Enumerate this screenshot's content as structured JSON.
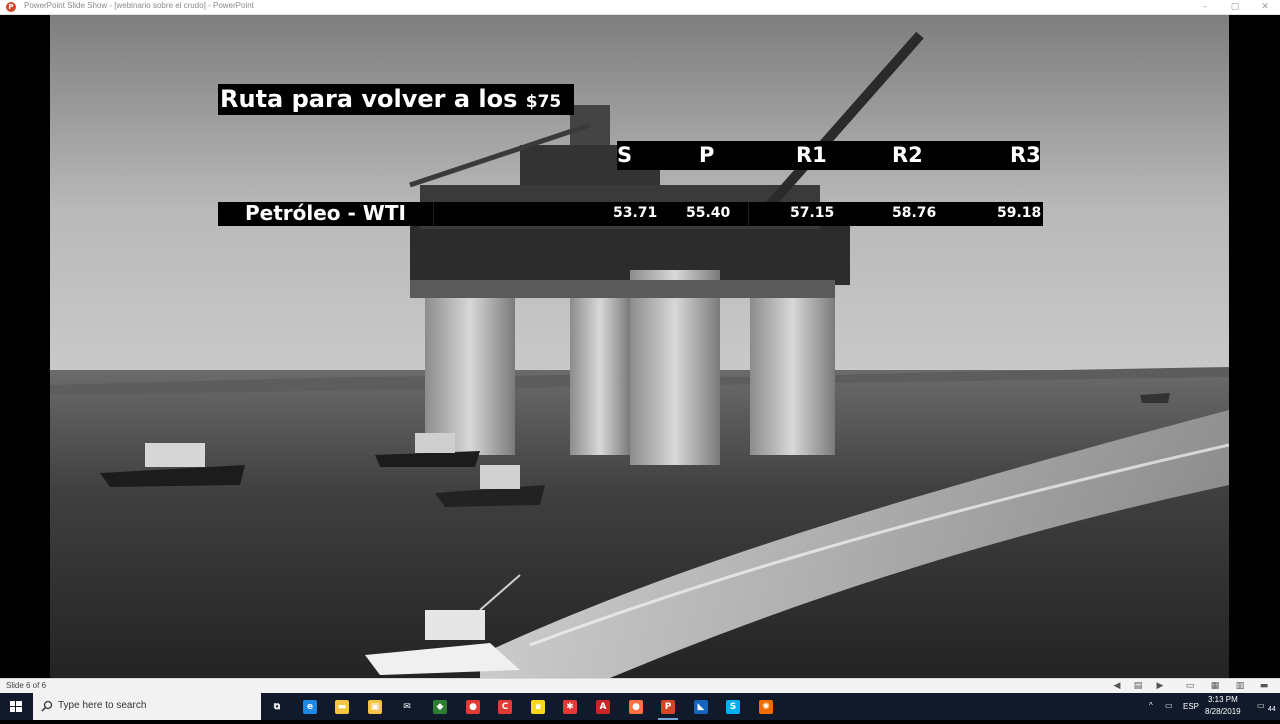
{
  "window": {
    "title": "PowerPoint Slide Show - [webinario sobre el crudo] - PowerPoint",
    "app_icon_letter": "P"
  },
  "slide": {
    "title_main": "Ruta para volver a los ",
    "title_price": "$75",
    "headers": [
      "S",
      "P",
      "R1",
      "R2",
      "R3"
    ],
    "row_label": "Petróleo - WTI",
    "values": [
      "53.71",
      "55.40",
      "57.15",
      "58.76",
      "59.18"
    ]
  },
  "statusbar": {
    "slide_counter": "Slide 6 of 6"
  },
  "taskbar": {
    "search_placeholder": "Type here to search",
    "apps": [
      {
        "name": "task-view",
        "letter": "⧉",
        "color": "#101a2b"
      },
      {
        "name": "edge",
        "letter": "e",
        "color": "#1e88e5"
      },
      {
        "name": "file-explorer",
        "letter": "▬",
        "color": "#f4c542"
      },
      {
        "name": "store",
        "letter": "▣",
        "color": "#f4c542"
      },
      {
        "name": "mail",
        "letter": "✉",
        "color": "#101a2b"
      },
      {
        "name": "app-green",
        "letter": "◆",
        "color": "#2e7d32"
      },
      {
        "name": "chrome",
        "letter": "●",
        "color": "#e53935"
      },
      {
        "name": "app-red",
        "letter": "C",
        "color": "#e53935"
      },
      {
        "name": "sticky-notes",
        "letter": "▪",
        "color": "#f9d71c"
      },
      {
        "name": "messaging",
        "letter": "✱",
        "color": "#e53935"
      },
      {
        "name": "acrobat",
        "letter": "A",
        "color": "#c62828"
      },
      {
        "name": "firefox",
        "letter": "●",
        "color": "#ff7043"
      },
      {
        "name": "powerpoint",
        "letter": "P",
        "color": "#d24726"
      },
      {
        "name": "app-blue",
        "letter": "◣",
        "color": "#1565c0"
      },
      {
        "name": "skype",
        "letter": "S",
        "color": "#00aff0"
      },
      {
        "name": "app-orange",
        "letter": "✺",
        "color": "#ef6c00"
      }
    ],
    "language": "ESP",
    "time": "3:13 PM",
    "date": "8/28/2019",
    "notification_count": "44"
  }
}
